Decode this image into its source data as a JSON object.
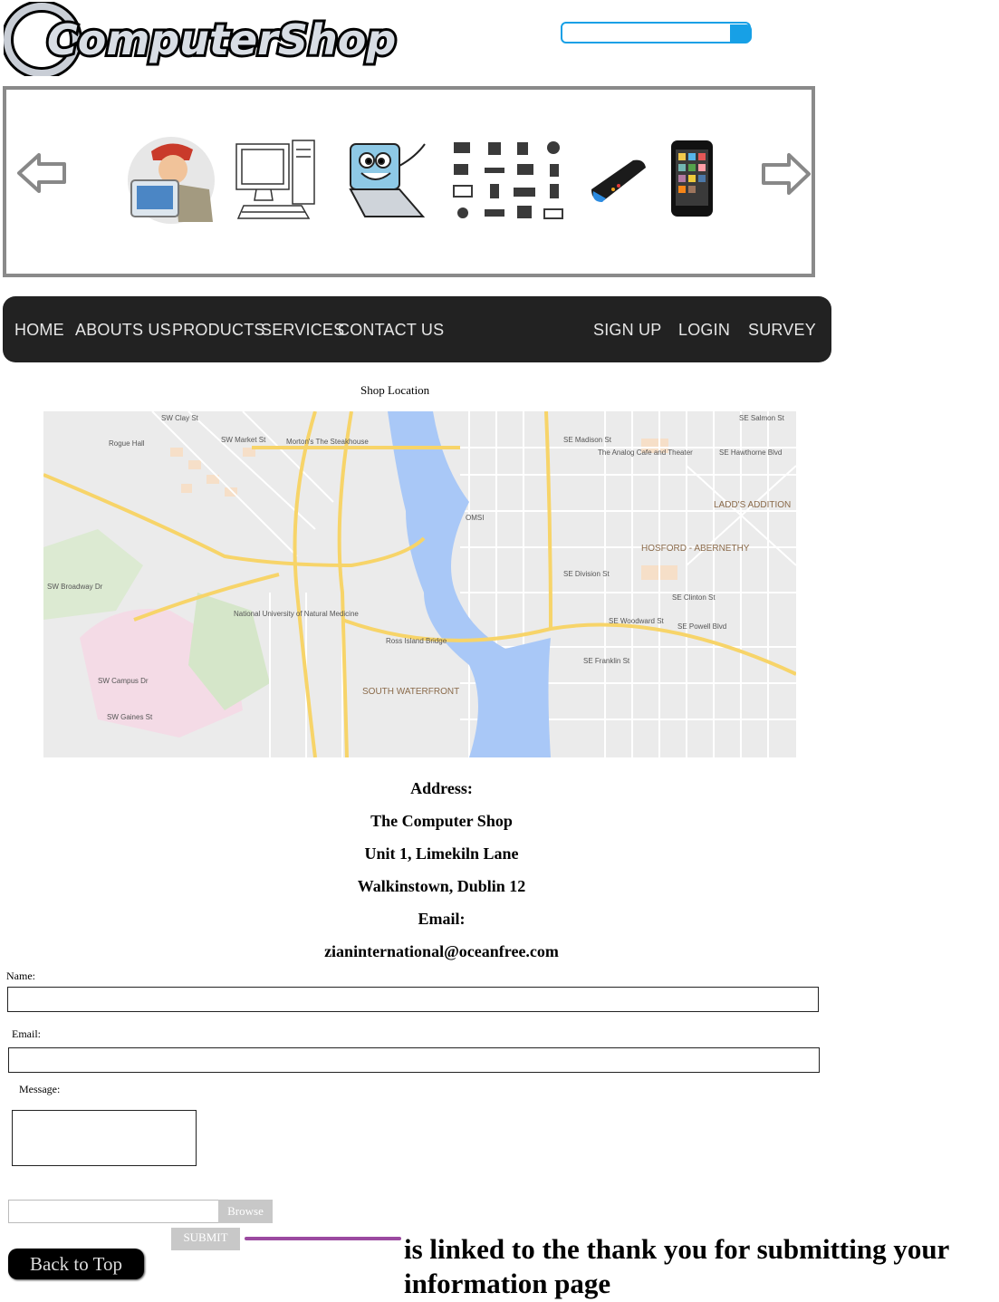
{
  "brand": {
    "logo_text": "ComputerShop"
  },
  "search": {
    "placeholder": ""
  },
  "nav": {
    "left": [
      "HOME",
      "ABOUTS US",
      "PRODUCTS",
      "SERVICES",
      "CONTACT US"
    ],
    "right": [
      "SIGN UP",
      "LOGIN",
      "SURVEY"
    ]
  },
  "map_section": {
    "caption": "Shop Location",
    "labels": {
      "mortons": "Morton's The Steakhouse",
      "rogue": "Rogue Hall",
      "analog": "The Analog Cafe and Theater",
      "ladds": "LADD'S ADDITION",
      "hosford": "HOSFORD - ABERNETHY",
      "omsi": "OMSI",
      "nunm": "National University of Natural Medicine",
      "ross": "Ross Island Bridge",
      "south_wf": "SOUTH WATERFRONT",
      "salmon": "SE Salmon St",
      "madison": "SE Madison St",
      "hawthorne": "SE Hawthorne Blvd",
      "division": "SE Division St",
      "clinton": "SE Clinton St",
      "woodward": "SE Woodward St",
      "powell": "SE Powell Blvd",
      "franklin": "SE Franklin St",
      "market": "SW Market St",
      "clay": "SW Clay St",
      "broadway": "SW Broadway Dr",
      "campus": "SW Campus Dr",
      "gaines": "SW Gaines St"
    }
  },
  "address": {
    "heading": "Address:",
    "line1": "The Computer Shop",
    "line2": "Unit 1, Limekiln Lane",
    "line3": "Walkinstown, Dublin 12",
    "email_heading": "Email:",
    "email": "zianinternational@oceanfree.com"
  },
  "form": {
    "name_label": "Name:",
    "email_label": "Email:",
    "message_label": "Message:",
    "browse_label": "Browse",
    "submit_label": "SUBMIT"
  },
  "back_to_top": "Back to Top",
  "annotation": "is linked to the thank you for submitting your information page",
  "colors": {
    "nav_bg": "#222222",
    "search_border": "#17a0e6",
    "river": "#a9c8f7",
    "annotation_line": "#9b4aa0"
  }
}
